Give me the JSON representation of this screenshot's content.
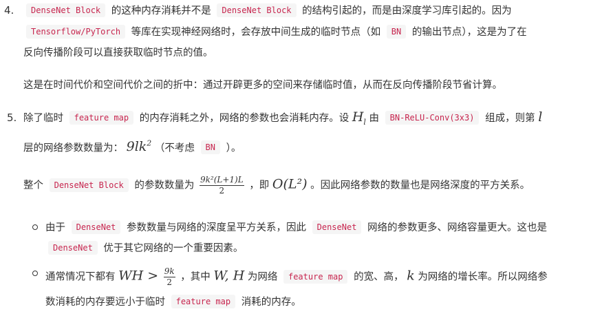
{
  "item4": {
    "number": "4.",
    "l1_code1": "DenseNet Block",
    "l1_t1": "的这种内存消耗并不是",
    "l1_code2": "DenseNet Block",
    "l1_t2": "的结构引起的，而是由深度学习库引起的。因为",
    "l2_code": "Tensorflow/PyTorch",
    "l2_t1": "等库在实现神经网络时，会存放中间生成的临时节点（如",
    "l2_code2": "BN",
    "l2_t2": "的输出节点），这是为了在",
    "l3_t": "反向传播阶段可以直接获取临时节点的值。",
    "para": "这是在时间代价和空间代价之间的折中：通过开辟更多的空间来存储临时值，从而在反向传播阶段节省计算。"
  },
  "item5": {
    "number": "5.",
    "l1_t1": "除了临时",
    "l1_code1": "feature map",
    "l1_t2": "的内存消耗之外，网络的参数也会消耗内存。设",
    "l1_math": "H",
    "l1_math_sub": "l",
    "l1_t3": "由",
    "l1_code2": "BN-ReLU-Conv(3x3)",
    "l1_t4": "组成，则第",
    "l1_math2": "l",
    "l2_t1": "层的网络参数数量为：",
    "l2_math": "9lk",
    "l2_math_sup": "2",
    "l2_t2": "（不考虑",
    "l2_code": "BN",
    "l2_t3": "）。",
    "p_t1": "整个",
    "p_code": "DenseNet Block",
    "p_t2": "的参数数量为",
    "p_frac_num": "9k²(L+1)L",
    "p_frac_den": "2",
    "p_t3": "，即",
    "p_math": "O(L²)",
    "p_t4": "。因此网络参数的数量也是网络深度的平方关系。",
    "b1_t1": "由于",
    "b1_code": "DenseNet",
    "b1_t2": "参数数量与网络的深度呈平方关系，因此",
    "b1_code2": "DenseNet",
    "b1_t3": "网络的参数更多、网络容量更大。这也是",
    "b1_l2_code": "DenseNet",
    "b1_l2_t": "优于其它网络的一个重要因素。",
    "b2_t1": "通常情况下都有",
    "b2_math": "WH >",
    "b2_frac_num": "9k",
    "b2_frac_den": "2",
    "b2_t2": "，其中",
    "b2_math2": "W, H",
    "b2_t3": "为网络",
    "b2_code": "feature map",
    "b2_t4": "的宽、高，",
    "b2_math3": "k",
    "b2_t5": "为网络的增长率。所以网络参",
    "b2_l2_t1": "数消耗的内存要远小于临时",
    "b2_l2_code": "feature map",
    "b2_l2_t2": "消耗的内存。"
  }
}
